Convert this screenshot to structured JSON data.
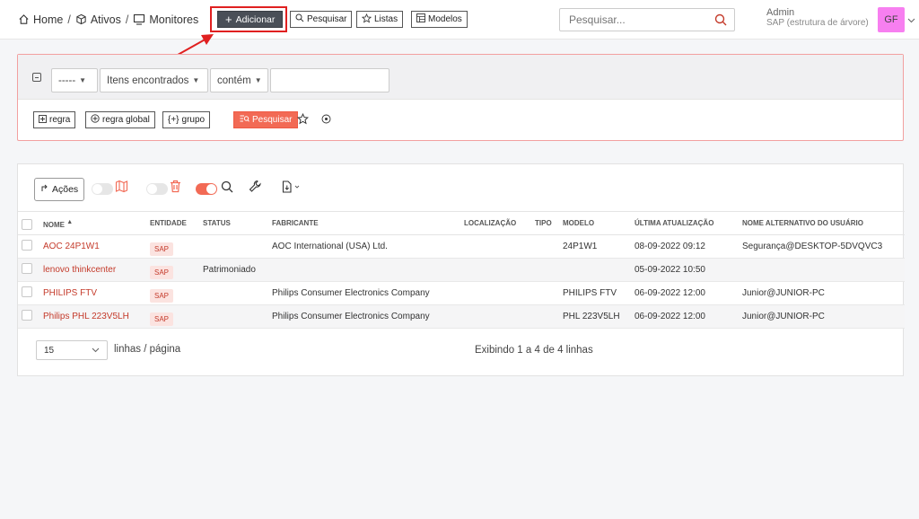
{
  "breadcrumb": {
    "home": "Home",
    "assets": "Ativos",
    "monitors": "Monitores"
  },
  "toolbar": {
    "add_label": "Adicionar",
    "search_label": "Pesquisar",
    "lists_label": "Listas",
    "models_label": "Modelos"
  },
  "global_search": {
    "placeholder": "Pesquisar..."
  },
  "user": {
    "name": "Admin",
    "entity": "SAP (estrutura de árvore)",
    "initials": "GF"
  },
  "filter": {
    "field_placeholder": "-----",
    "criteria": "Itens encontrados",
    "operator": "contém",
    "value": "",
    "buttons": {
      "rule": "regra",
      "global_rule": "regra global",
      "group": "grupo",
      "search": "Pesquisar"
    }
  },
  "results": {
    "actions_label": "Ações",
    "columns": {
      "name": "NOME",
      "entity": "ENTIDADE",
      "status": "STATUS",
      "manufacturer": "FABRICANTE",
      "location": "LOCALIZAÇÃO",
      "type": "TIPO",
      "model": "MODELO",
      "updated": "ÚLTIMA ATUALIZAÇÃO",
      "alt_user": "NOME ALTERNATIVO DO USUÁRIO"
    },
    "rows": [
      {
        "name": "AOC 24P1W1",
        "entity": "SAP",
        "status": "",
        "manufacturer": "AOC International (USA) Ltd.",
        "location": "",
        "type": "",
        "model": "24P1W1",
        "updated": "08-09-2022 09:12",
        "alt_user": "Segurança@DESKTOP-5DVQVC3"
      },
      {
        "name": "lenovo thinkcenter",
        "entity": "SAP",
        "status": "Patrimoniado",
        "manufacturer": "",
        "location": "",
        "type": "",
        "model": "",
        "updated": "05-09-2022 10:50",
        "alt_user": ""
      },
      {
        "name": "PHILIPS FTV",
        "entity": "SAP",
        "status": "",
        "manufacturer": "Philips Consumer Electronics Company",
        "location": "",
        "type": "",
        "model": "PHILIPS FTV",
        "updated": "06-09-2022 12:00",
        "alt_user": "Junior@JUNIOR-PC"
      },
      {
        "name": "Philips PHL 223V5LH",
        "entity": "SAP",
        "status": "",
        "manufacturer": "Philips Consumer Electronics Company",
        "location": "",
        "type": "",
        "model": "PHL 223V5LH",
        "updated": "06-09-2022 12:00",
        "alt_user": "Junior@JUNIOR-PC"
      }
    ],
    "page_size": "15",
    "page_size_label": "linhas / página",
    "showing": "Exibindo 1 a 4 de 4 linhas"
  },
  "colors": {
    "accent": "#f26a55",
    "link": "#c43a2a",
    "annotation": "#e02020",
    "avatar": "#f77ff0"
  }
}
